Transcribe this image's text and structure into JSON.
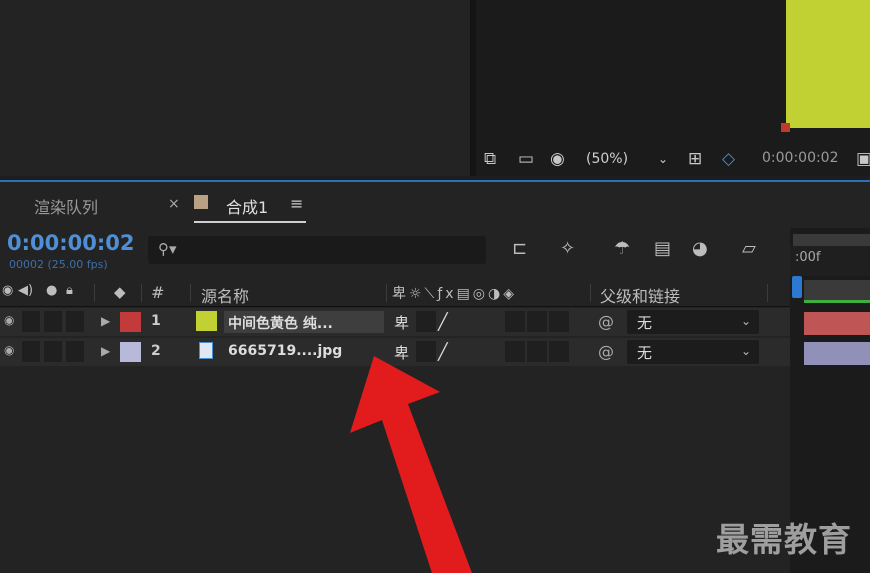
{
  "viewer": {
    "zoom": "(50%)",
    "timecode": "0:00:00:02",
    "comp_color": "#c1d032"
  },
  "tabs": {
    "render_queue": "渲染队列",
    "close_glyph": "×",
    "comp_label": "合成1",
    "menu_glyph": "≡"
  },
  "panel": {
    "current_time": "0:00:00:02",
    "frames": "00002 (25.00 fps)",
    "search_placeholder": ""
  },
  "columns": {
    "number": "#",
    "source_name": "源名称",
    "parent_link": "父级和链接"
  },
  "layers": [
    {
      "number": "1",
      "label_color": "#c23a3a",
      "name": "中间色黄色 纯...",
      "parent": "无",
      "thumb_color": "#c1d032",
      "bar_color": "#c05555"
    },
    {
      "number": "2",
      "label_color": "#b8b8d8",
      "name": "6665719....jpg",
      "parent": "无",
      "thumb_color": "#4a90d0",
      "bar_color": "#9090b8"
    }
  ],
  "timeline": {
    "ruler_label": ":00f"
  },
  "watermark": "最需教育"
}
